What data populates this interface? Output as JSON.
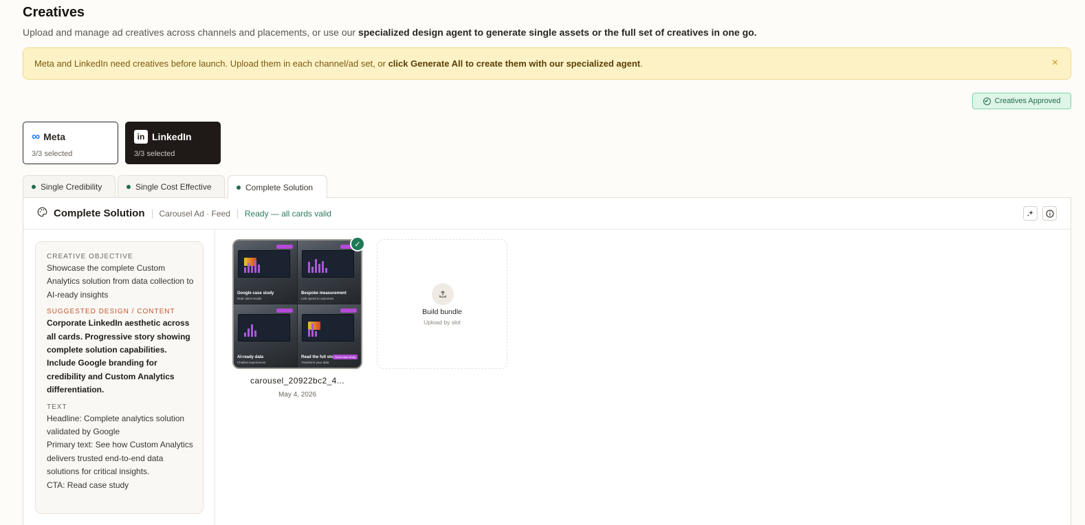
{
  "page": {
    "title": "Creatives",
    "subtitle_plain": "Upload and manage ad creatives across channels and placements, or use our ",
    "subtitle_bold": "specialized design agent to generate single assets or the full set of creatives in one go."
  },
  "banner": {
    "text_plain": "Meta and LinkedIn need creatives before launch. Upload them in each channel/ad set, or ",
    "text_bold": "click Generate All to create them with our specialized agent",
    "text_end": ".",
    "close_icon": "×"
  },
  "status_badge": {
    "label": "Creatives Approved"
  },
  "channels": [
    {
      "name": "Meta",
      "count": "3/3 selected",
      "icon": "meta-logo"
    },
    {
      "name": "LinkedIn",
      "count": "3/3 selected",
      "icon": "linkedin-logo"
    }
  ],
  "tabs": [
    {
      "label": "Single Credibility"
    },
    {
      "label": "Single Cost Effective"
    },
    {
      "label": "Complete Solution"
    }
  ],
  "panel": {
    "title": "Complete Solution",
    "format": "Carousel Ad · Feed",
    "status": "Ready — all cards valid"
  },
  "brief": {
    "objective_label": "Creative Objective",
    "objective_text": "Showcase the complete Custom Analytics solution from data collection to AI-ready insights",
    "design_label": "Suggested Design / Content",
    "design_text": "Corporate LinkedIn aesthetic across all cards. Progressive story showing complete solution capabilities. Include Google branding for credibility and Custom Analytics differentiation.",
    "text_label": "Text",
    "headline": "Headline: Complete analytics solution validated by Google",
    "primary_text": "Primary text: See how Custom Analytics delivers trusted end-to-end data solutions for critical insights.",
    "cta": "CTA: Read case study"
  },
  "creative": {
    "file_name": "carousel_20922bc2_4...",
    "date": "May 4, 2026",
    "tiles": [
      {
        "caption": "Google case study",
        "sub": "Real client results"
      },
      {
        "caption": "Bespoke measurement",
        "sub": "Link spend to outcomes"
      },
      {
        "caption": "AI-ready data",
        "sub": "Chatbot experiences"
      },
      {
        "caption": "Read the full story",
        "sub": "Transform your data",
        "cta": "Read case study"
      }
    ]
  },
  "upload_slot": {
    "title": "Build bundle",
    "subtitle": "Upload by slot"
  },
  "colors": {
    "accent_green": "#1e7a56",
    "linkedin_card": "#1f1a17",
    "banner_bg": "#fdf2c5"
  }
}
